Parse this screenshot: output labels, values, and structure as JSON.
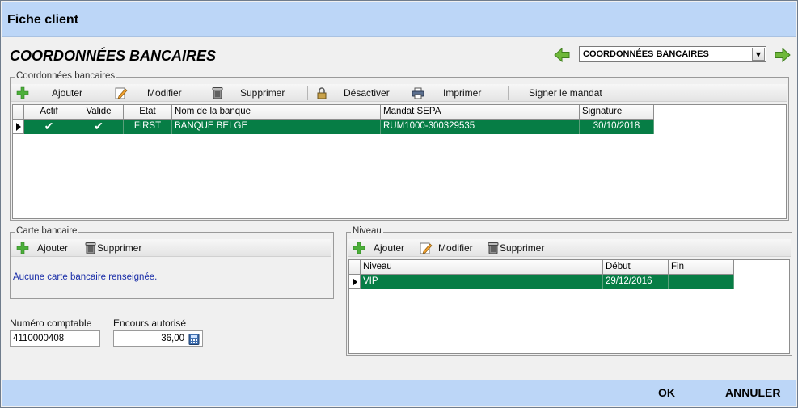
{
  "window": {
    "title": "Fiche client"
  },
  "header": {
    "section_title": "COORDONNÉES BANCAIRES",
    "selector_value": "COORDONNÉES BANCAIRES"
  },
  "bank_details": {
    "label": "Coordonnées bancaires",
    "toolbar": {
      "add": "Ajouter",
      "edit": "Modifier",
      "delete": "Supprimer",
      "deactivate": "Désactiver",
      "print": "Imprimer",
      "sign": "Signer le mandat"
    },
    "columns": [
      "Actif",
      "Valide",
      "Etat",
      "Nom de la banque",
      "Mandat SEPA",
      "Signature"
    ],
    "rows": [
      {
        "actif": "✔",
        "valide": "✔",
        "etat": "FIRST",
        "banque": "BANQUE BELGE",
        "mandat": "RUM1000-300329535",
        "signature": "30/10/2018"
      }
    ]
  },
  "card": {
    "label": "Carte bancaire",
    "toolbar": {
      "add": "Ajouter",
      "delete": "Supprimer"
    },
    "empty_message": "Aucune carte bancaire renseignée."
  },
  "level": {
    "label": "Niveau",
    "toolbar": {
      "add": "Ajouter",
      "edit": "Modifier",
      "delete": "Supprimer"
    },
    "columns": [
      "Niveau",
      "Début",
      "Fin"
    ],
    "rows": [
      {
        "niveau": "VIP",
        "debut": "29/12/2016",
        "fin": ""
      }
    ]
  },
  "fields": {
    "account_number_label": "Numéro comptable",
    "account_number_value": "4110000408",
    "credit_label": "Encours autorisé",
    "credit_value": "36,00"
  },
  "footer": {
    "ok": "OK",
    "cancel": "ANNULER"
  },
  "colors": {
    "accent": "#bcd6f7",
    "selected_row": "#067d45"
  }
}
